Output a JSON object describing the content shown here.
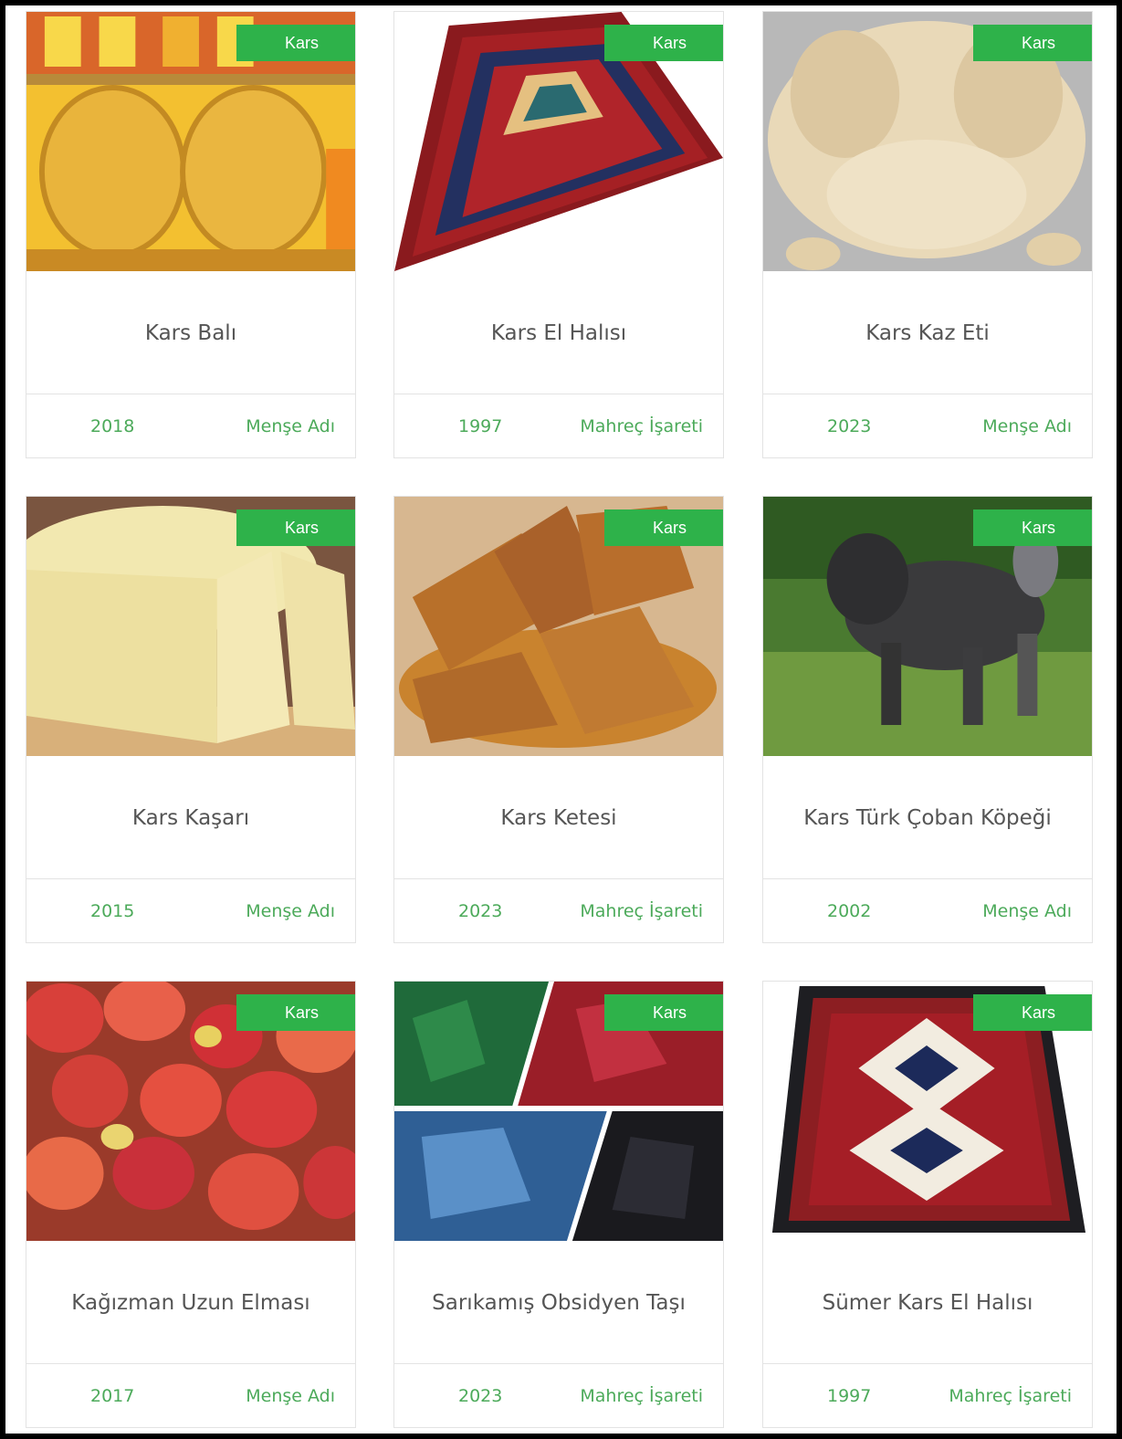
{
  "cards": [
    {
      "region": "Kars",
      "title": "Kars Balı",
      "year": "2018",
      "type": "Menşe Adı",
      "image": "honeycomb-image"
    },
    {
      "region": "Kars",
      "title": "Kars El Halısı",
      "year": "1997",
      "type": "Mahreç İşareti",
      "image": "carpet-image"
    },
    {
      "region": "Kars",
      "title": "Kars Kaz Eti",
      "year": "2023",
      "type": "Menşe Adı",
      "image": "goose-meat-image"
    },
    {
      "region": "Kars",
      "title": "Kars Kaşarı",
      "year": "2015",
      "type": "Menşe Adı",
      "image": "cheese-image"
    },
    {
      "region": "Kars",
      "title": "Kars Ketesi",
      "year": "2023",
      "type": "Mahreç İşareti",
      "image": "pastry-image"
    },
    {
      "region": "Kars",
      "title": "Kars Türk Çoban Köpeği",
      "year": "2002",
      "type": "Menşe Adı",
      "image": "shepherd-dog-image"
    },
    {
      "region": "Kars",
      "title": "Kağızman Uzun Elması",
      "year": "2017",
      "type": "Menşe Adı",
      "image": "apples-image"
    },
    {
      "region": "Kars",
      "title": "Sarıkamış Obsidyen Taşı",
      "year": "2023",
      "type": "Mahreç İşareti",
      "image": "obsidian-image"
    },
    {
      "region": "Kars",
      "title": "Sümer Kars El Halısı",
      "year": "1997",
      "type": "Mahreç İşareti",
      "image": "sumer-carpet-image"
    }
  ],
  "colors": {
    "ribbon": "#2eb24a",
    "accent_text": "#4caa5a",
    "title_text": "#555555",
    "frame": "#000000"
  }
}
